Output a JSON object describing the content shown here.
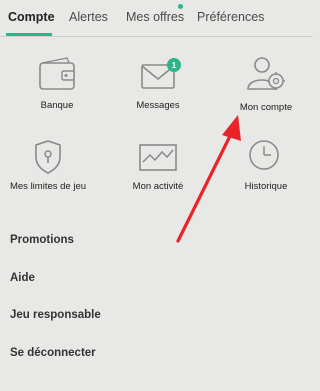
{
  "tabs": [
    {
      "label": "Compte",
      "active": true
    },
    {
      "label": "Alertes",
      "active": false
    },
    {
      "label": "Mes offres",
      "active": false
    },
    {
      "label": "Préférences",
      "active": false
    }
  ],
  "tiles": [
    {
      "label": "Banque",
      "icon": "wallet-icon"
    },
    {
      "label": "Messages",
      "icon": "envelope-icon",
      "badge": "1"
    },
    {
      "label": "Mon compte",
      "icon": "user-settings-icon"
    },
    {
      "label": "Mes limites de jeu",
      "icon": "shield-lock-icon"
    },
    {
      "label": "Mon activité",
      "icon": "activity-chart-icon"
    },
    {
      "label": "Historique",
      "icon": "clock-icon"
    }
  ],
  "menu": [
    {
      "label": "Promotions"
    },
    {
      "label": "Aide"
    },
    {
      "label": "Jeu responsable"
    },
    {
      "label": "Se déconnecter"
    }
  ],
  "colors": {
    "background": "#e8e8e6",
    "accent": "#2bb58a",
    "icon_stroke": "#8a8a8a",
    "annotation_arrow": "#e8242a"
  }
}
